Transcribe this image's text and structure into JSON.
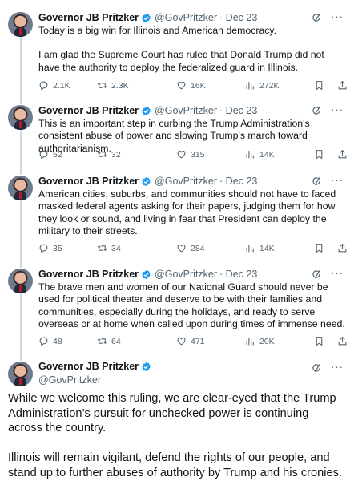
{
  "author": {
    "name": "Governor JB Pritzker",
    "handle": "@GovPritzker"
  },
  "colors": {
    "verified": "#1d9bf0",
    "text": "#0f1419",
    "meta": "#536471",
    "thread_line": "#cfd9de"
  },
  "icons": {
    "verified": "verified-badge-icon",
    "grok": "grok-icon",
    "more": "more-options-icon",
    "reply": "reply-icon",
    "retweet": "retweet-icon",
    "like": "heart-icon",
    "views": "views-chart-icon",
    "bookmark": "bookmark-icon",
    "share": "share-icon"
  },
  "tweets": [
    {
      "date": "· Dec 23",
      "paragraphs": [
        "Today is a big win for Illinois and American democracy.",
        "I am glad the Supreme Court has ruled that Donald Trump did not have the authority to deploy the federalized guard in Illinois."
      ],
      "stats": {
        "replies": "2.1K",
        "reposts": "2.3K",
        "likes": "16K",
        "views": "272K"
      }
    },
    {
      "date": "· Dec 23",
      "paragraphs": [
        "This is an important step in curbing the Trump Administration's consistent abuse of power and slowing Trump's march toward authoritarianism."
      ],
      "stats": {
        "replies": "52",
        "reposts": "32",
        "likes": "315",
        "views": "14K"
      }
    },
    {
      "date": "· Dec 23",
      "paragraphs": [
        "American cities, suburbs, and communities should not have to faced masked federal agents asking for their papers, judging them for how they look or sound, and living in fear that President can deploy the military to their streets."
      ],
      "stats": {
        "replies": "35",
        "reposts": "34",
        "likes": "284",
        "views": "14K"
      }
    },
    {
      "date": "· Dec 23",
      "paragraphs": [
        "The brave men and women of our National Guard should never be used for political theater and deserve to be with their families and communities, especially during the holidays, and ready to serve overseas or at home when called upon during times of immense need."
      ],
      "stats": {
        "replies": "48",
        "reposts": "64",
        "likes": "471",
        "views": "20K"
      }
    }
  ],
  "main_tweet": {
    "paragraphs": [
      "While we welcome this ruling, we are clear-eyed that the Trump Administration’s pursuit for unchecked power is continuing across the country.",
      "Illinois will remain vigilant, defend the rights of our people, and stand up to further abuses of authority by Trump and his cronies."
    ]
  }
}
